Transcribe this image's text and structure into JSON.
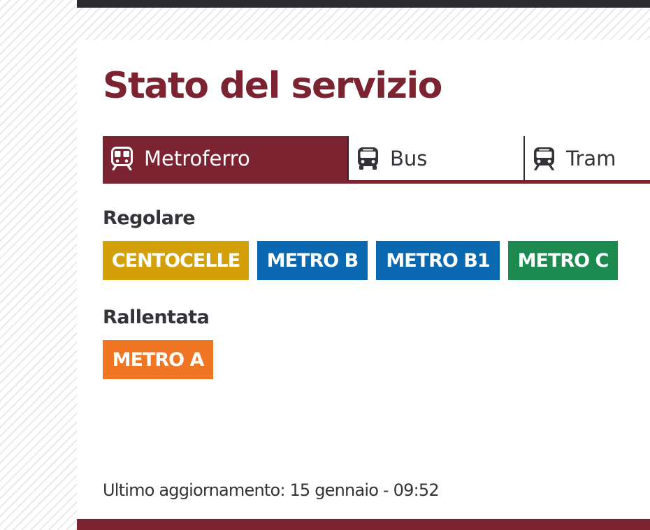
{
  "colors": {
    "brand": "#7b2331",
    "text": "#333438",
    "centocelle": "#d4a00a",
    "metro_b": "#0a68b1",
    "metro_b1": "#0a68b1",
    "metro_c": "#1c8a4f",
    "metro_a": "#f07623"
  },
  "page": {
    "title": "Stato del servizio"
  },
  "tabs": [
    {
      "label": "Metroferro",
      "icon": "train-icon",
      "active": true
    },
    {
      "label": "Bus",
      "icon": "bus-icon",
      "active": false
    },
    {
      "label": "Tram",
      "icon": "tram-icon",
      "active": false
    }
  ],
  "groups": {
    "regolare": {
      "label": "Regolare",
      "lines": [
        {
          "label": "CENTOCELLE",
          "color": "#d4a00a"
        },
        {
          "label": "METRO B",
          "color": "#0a68b1"
        },
        {
          "label": "METRO B1",
          "color": "#0a68b1"
        },
        {
          "label": "METRO C",
          "color": "#1c8a4f"
        }
      ]
    },
    "rallentata": {
      "label": "Rallentata",
      "lines": [
        {
          "label": "METRO A",
          "color": "#f07623"
        }
      ]
    }
  },
  "footer": {
    "last_update": "Ultimo aggiornamento: 15 gennaio - 09:52"
  }
}
